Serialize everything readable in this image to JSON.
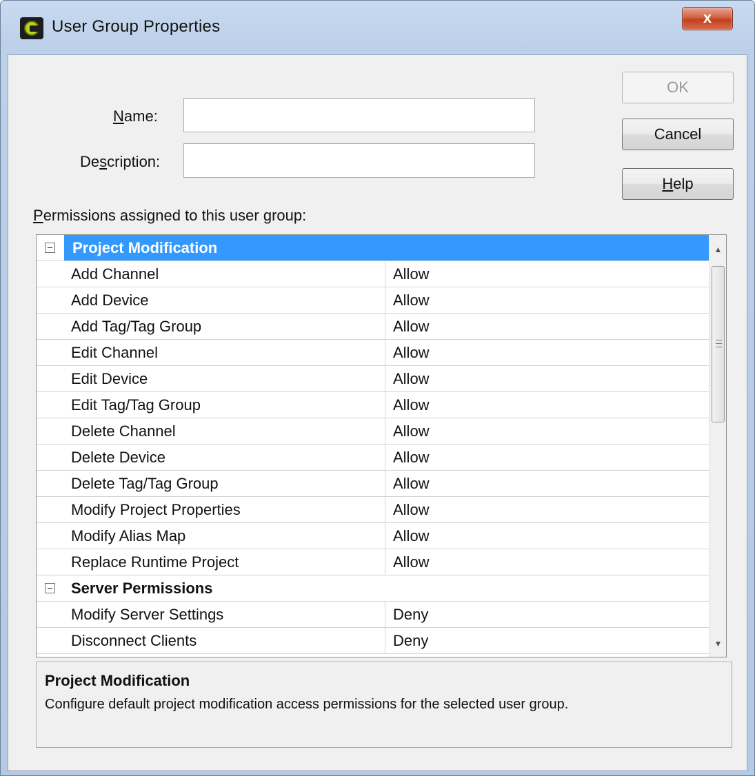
{
  "window": {
    "title": "User Group Properties",
    "close_label": "x"
  },
  "form": {
    "name_label_prefix": "",
    "name_label_mnemonic": "N",
    "name_label_rest": "ame:",
    "name_value": "",
    "description_label_prefix": "De",
    "description_label_mnemonic": "s",
    "description_label_rest": "cription:",
    "description_value": ""
  },
  "buttons": {
    "ok": "OK",
    "cancel": "Cancel",
    "help_mnemonic": "H",
    "help_rest": "elp"
  },
  "permissions": {
    "label_mnemonic": "P",
    "label_rest": "ermissions assigned to this user group:",
    "categories": [
      {
        "name": "Project Modification",
        "expanded": true,
        "selected": true,
        "items": [
          {
            "name": "Add Channel",
            "value": "Allow"
          },
          {
            "name": "Add Device",
            "value": "Allow"
          },
          {
            "name": "Add Tag/Tag Group",
            "value": "Allow"
          },
          {
            "name": "Edit Channel",
            "value": "Allow"
          },
          {
            "name": "Edit Device",
            "value": "Allow"
          },
          {
            "name": "Edit Tag/Tag Group",
            "value": "Allow"
          },
          {
            "name": "Delete Channel",
            "value": "Allow"
          },
          {
            "name": "Delete Device",
            "value": "Allow"
          },
          {
            "name": "Delete Tag/Tag Group",
            "value": "Allow"
          },
          {
            "name": "Modify Project Properties",
            "value": "Allow"
          },
          {
            "name": "Modify Alias Map",
            "value": "Allow"
          },
          {
            "name": "Replace Runtime Project",
            "value": "Allow"
          }
        ]
      },
      {
        "name": "Server Permissions",
        "expanded": true,
        "selected": false,
        "items": [
          {
            "name": "Modify Server Settings",
            "value": "Deny"
          },
          {
            "name": "Disconnect Clients",
            "value": "Deny"
          }
        ]
      }
    ]
  },
  "description": {
    "title": "Project Modification",
    "text": "Configure default project modification access permissions for the selected user group."
  },
  "colors": {
    "selection": "#3399ff",
    "close_button": "#c2401d",
    "title_bar": "#b4c9e4"
  }
}
